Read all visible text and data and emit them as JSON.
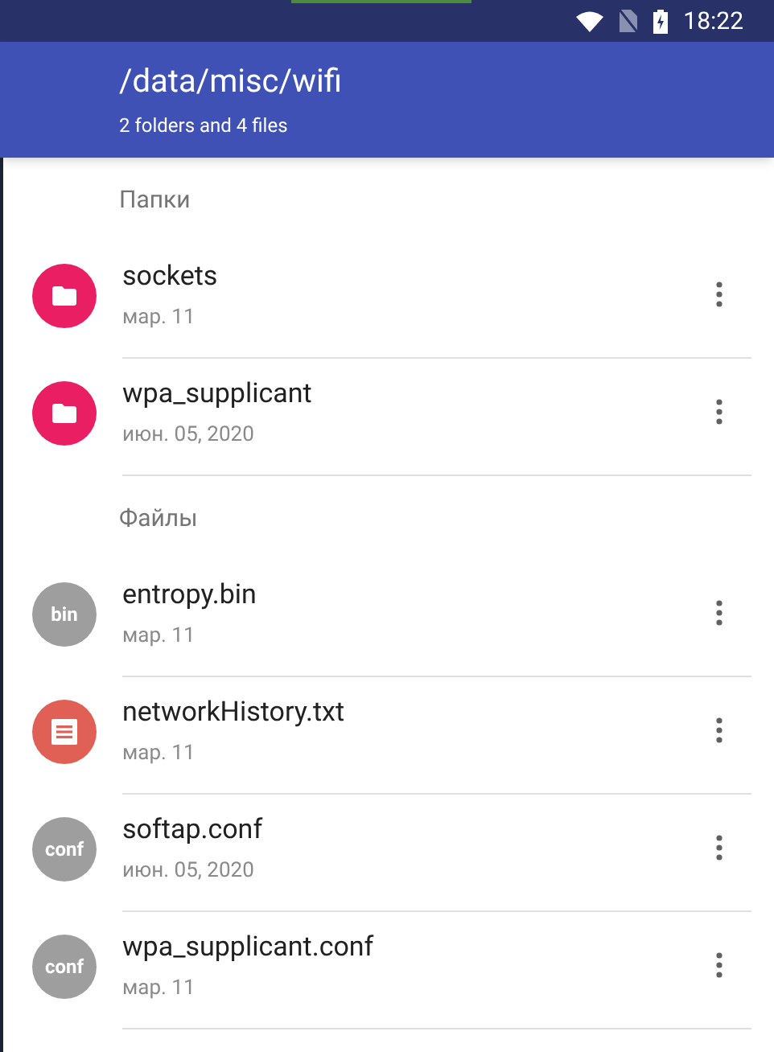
{
  "status_bar": {
    "time": "18:22"
  },
  "header": {
    "title": "/data/misc/wifi",
    "subtitle": "2 folders and 4 files"
  },
  "sections": [
    {
      "title": "Папки",
      "items": [
        {
          "name": "sockets",
          "date": "мар. 11",
          "kind": "folder",
          "color": "#e91e63"
        },
        {
          "name": "wpa_supplicant",
          "date": "июн. 05, 2020",
          "kind": "folder",
          "color": "#e91e63"
        }
      ]
    },
    {
      "title": "Файлы",
      "items": [
        {
          "name": "entropy.bin",
          "date": "мар. 11",
          "kind": "label",
          "label": "bin",
          "color": "#9e9e9e"
        },
        {
          "name": "networkHistory.txt",
          "date": "мар. 11",
          "kind": "document",
          "color": "#e06055"
        },
        {
          "name": "softap.conf",
          "date": "июн. 05, 2020",
          "kind": "label",
          "label": "conf",
          "color": "#9e9e9e"
        },
        {
          "name": "wpa_supplicant.conf",
          "date": "мар. 11",
          "kind": "label",
          "label": "conf",
          "color": "#9e9e9e"
        }
      ]
    }
  ]
}
